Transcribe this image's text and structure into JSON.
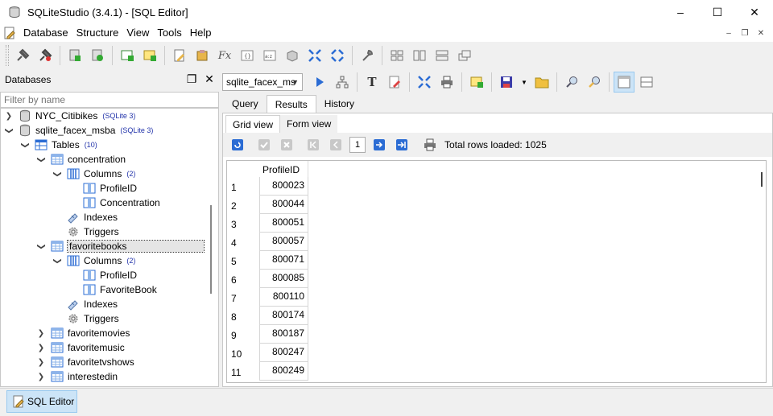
{
  "window": {
    "title": "SQLiteStudio (3.4.1) - [SQL Editor]",
    "minimize": "–",
    "maximize": "☐",
    "close": "✕"
  },
  "menu": {
    "items": [
      "Database",
      "Structure",
      "View",
      "Tools",
      "Help"
    ]
  },
  "databases_panel": {
    "title": "Databases",
    "filter_placeholder": "Filter by name",
    "tree": [
      {
        "label": "NYC_Citibikes",
        "badge": "(SQLite 3)"
      },
      {
        "label": "sqlite_facex_msba",
        "badge": "(SQLite 3)"
      },
      {
        "label": "Tables",
        "badge": "(10)"
      },
      {
        "label": "concentration",
        "badge": ""
      },
      {
        "label": "Columns",
        "badge": "(2)"
      },
      {
        "label": "ProfileID",
        "badge": ""
      },
      {
        "label": "Concentration",
        "badge": ""
      },
      {
        "label": "Indexes",
        "badge": ""
      },
      {
        "label": "Triggers",
        "badge": ""
      },
      {
        "label": "favoritebooks",
        "badge": ""
      },
      {
        "label": "Columns",
        "badge": "(2)"
      },
      {
        "label": "ProfileID",
        "badge": ""
      },
      {
        "label": "FavoriteBook",
        "badge": ""
      },
      {
        "label": "Indexes",
        "badge": ""
      },
      {
        "label": "Triggers",
        "badge": ""
      },
      {
        "label": "favoritemovies",
        "badge": ""
      },
      {
        "label": "favoritemusic",
        "badge": ""
      },
      {
        "label": "favoritetvshows",
        "badge": ""
      },
      {
        "label": "interestedin",
        "badge": ""
      }
    ]
  },
  "editor": {
    "db_select": "sqlite_facex_ms",
    "tabs": [
      "Query",
      "Results",
      "History"
    ],
    "subtabs": [
      "Grid view",
      "Form view"
    ],
    "page": "1",
    "total_rows": "Total rows loaded: 1025",
    "grid": {
      "column": "ProfileID",
      "rows": [
        {
          "n": "1",
          "v": "800023"
        },
        {
          "n": "2",
          "v": "800044"
        },
        {
          "n": "3",
          "v": "800051"
        },
        {
          "n": "4",
          "v": "800057"
        },
        {
          "n": "5",
          "v": "800071"
        },
        {
          "n": "6",
          "v": "800085"
        },
        {
          "n": "7",
          "v": "800110"
        },
        {
          "n": "8",
          "v": "800174"
        },
        {
          "n": "9",
          "v": "800187"
        },
        {
          "n": "10",
          "v": "800247"
        },
        {
          "n": "11",
          "v": "800249"
        }
      ]
    }
  },
  "taskbar": {
    "sql_editor_label": "SQL Editor"
  },
  "colors": {
    "accent_blue": "#2b6cd4",
    "selection": "#cce4f7",
    "badge_blue": "#2233aa"
  }
}
